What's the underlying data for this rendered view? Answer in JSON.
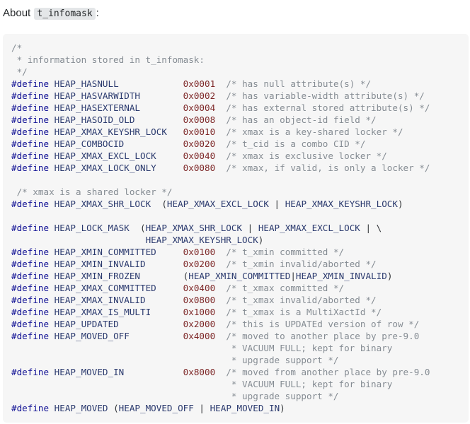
{
  "intro": {
    "text": "About",
    "code": "t_infomask",
    "suffix": ":"
  },
  "code_lines": [
    "/*",
    " * information stored in t_infomask:",
    " */",
    "#define HEAP_HASNULL            0x0001  /* has null attribute(s) */",
    "#define HEAP_HASVARWIDTH        0x0002  /* has variable-width attribute(s) */",
    "#define HEAP_HASEXTERNAL        0x0004  /* has external stored attribute(s) */",
    "#define HEAP_HASOID_OLD         0x0008  /* has an object-id field */",
    "#define HEAP_XMAX_KEYSHR_LOCK   0x0010  /* xmax is a key-shared locker */",
    "#define HEAP_COMBOCID           0x0020  /* t_cid is a combo CID */",
    "#define HEAP_XMAX_EXCL_LOCK     0x0040  /* xmax is exclusive locker */",
    "#define HEAP_XMAX_LOCK_ONLY     0x0080  /* xmax, if valid, is only a locker */",
    "",
    " /* xmax is a shared locker */",
    "#define HEAP_XMAX_SHR_LOCK  (HEAP_XMAX_EXCL_LOCK | HEAP_XMAX_KEYSHR_LOCK)",
    "",
    "#define HEAP_LOCK_MASK  (HEAP_XMAX_SHR_LOCK | HEAP_XMAX_EXCL_LOCK | \\",
    "                         HEAP_XMAX_KEYSHR_LOCK)",
    "#define HEAP_XMIN_COMMITTED     0x0100  /* t_xmin committed */",
    "#define HEAP_XMIN_INVALID       0x0200  /* t_xmin invalid/aborted */",
    "#define HEAP_XMIN_FROZEN        (HEAP_XMIN_COMMITTED|HEAP_XMIN_INVALID)",
    "#define HEAP_XMAX_COMMITTED     0x0400  /* t_xmax committed */",
    "#define HEAP_XMAX_INVALID       0x0800  /* t_xmax invalid/aborted */",
    "#define HEAP_XMAX_IS_MULTI      0x1000  /* t_xmax is a MultiXactId */",
    "#define HEAP_UPDATED            0x2000  /* this is UPDATEd version of row */",
    "#define HEAP_MOVED_OFF          0x4000  /* moved to another place by pre-9.0",
    "                                         * VACUUM FULL; kept for binary",
    "                                         * upgrade support */",
    "#define HEAP_MOVED_IN           0x8000  /* moved from another place by pre-9.0",
    "                                         * VACUUM FULL; kept for binary",
    "                                         * upgrade support */",
    "#define HEAP_MOVED (HEAP_MOVED_OFF | HEAP_MOVED_IN)"
  ]
}
